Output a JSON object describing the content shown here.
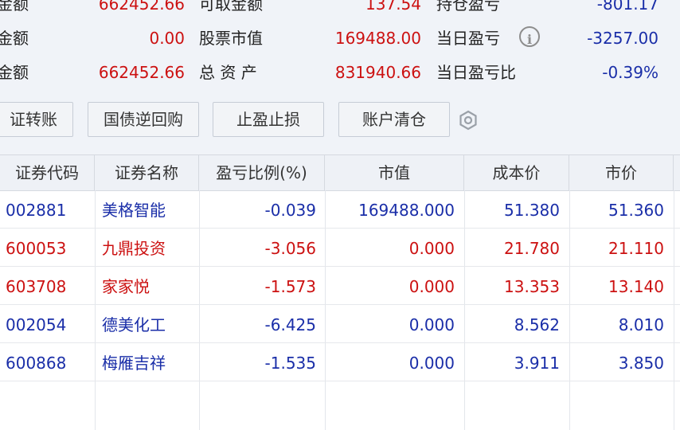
{
  "summary": {
    "row1": {
      "label1": "金额",
      "value1": "662452.66",
      "label2": "可取金额",
      "value2": "137.54",
      "label3": "持仓盈亏",
      "value3": "-801.17"
    },
    "row2": {
      "label1": "金额",
      "value1": "0.00",
      "label2": "股票市值",
      "value2": "169488.00",
      "label3": "当日盈亏",
      "value3": "-3257.00"
    },
    "row3": {
      "label1": "金额",
      "value1": "662452.66",
      "label2": "总 资 产",
      "value2": "831940.66",
      "label3": "当日盈亏比",
      "value3": "-0.39%"
    }
  },
  "toolbar": {
    "transfer": "证转账",
    "repo": "国债逆回购",
    "stop": "止盈止损",
    "clear": "账户清仓"
  },
  "table": {
    "headers": {
      "code": "证券代码",
      "name": "证券名称",
      "pct": "盈亏比例(%)",
      "mv": "市值",
      "cost": "成本价",
      "price": "市价"
    },
    "rows": [
      {
        "code": "002881",
        "name": "美格智能",
        "pct": "-0.039",
        "mv": "169488.000",
        "cost": "51.380",
        "price": "51.360",
        "color": "#1a2ea8"
      },
      {
        "code": "600053",
        "name": "九鼎投资",
        "pct": "-3.056",
        "mv": "0.000",
        "cost": "21.780",
        "price": "21.110",
        "color": "#cc1111"
      },
      {
        "code": "603708",
        "name": "家家悦",
        "pct": "-1.573",
        "mv": "0.000",
        "cost": "13.353",
        "price": "13.140",
        "color": "#cc1111"
      },
      {
        "code": "002054",
        "name": "德美化工",
        "pct": "-6.425",
        "mv": "0.000",
        "cost": "8.562",
        "price": "8.010",
        "color": "#1a2ea8"
      },
      {
        "code": "600868",
        "name": "梅雁吉祥",
        "pct": "-1.535",
        "mv": "0.000",
        "cost": "3.911",
        "price": "3.850",
        "color": "#1a2ea8"
      }
    ]
  },
  "colors": {
    "up": "#cc1111",
    "down": "#1a2ea8"
  },
  "icons": {
    "info": "info-icon",
    "settings": "gear-icon"
  }
}
